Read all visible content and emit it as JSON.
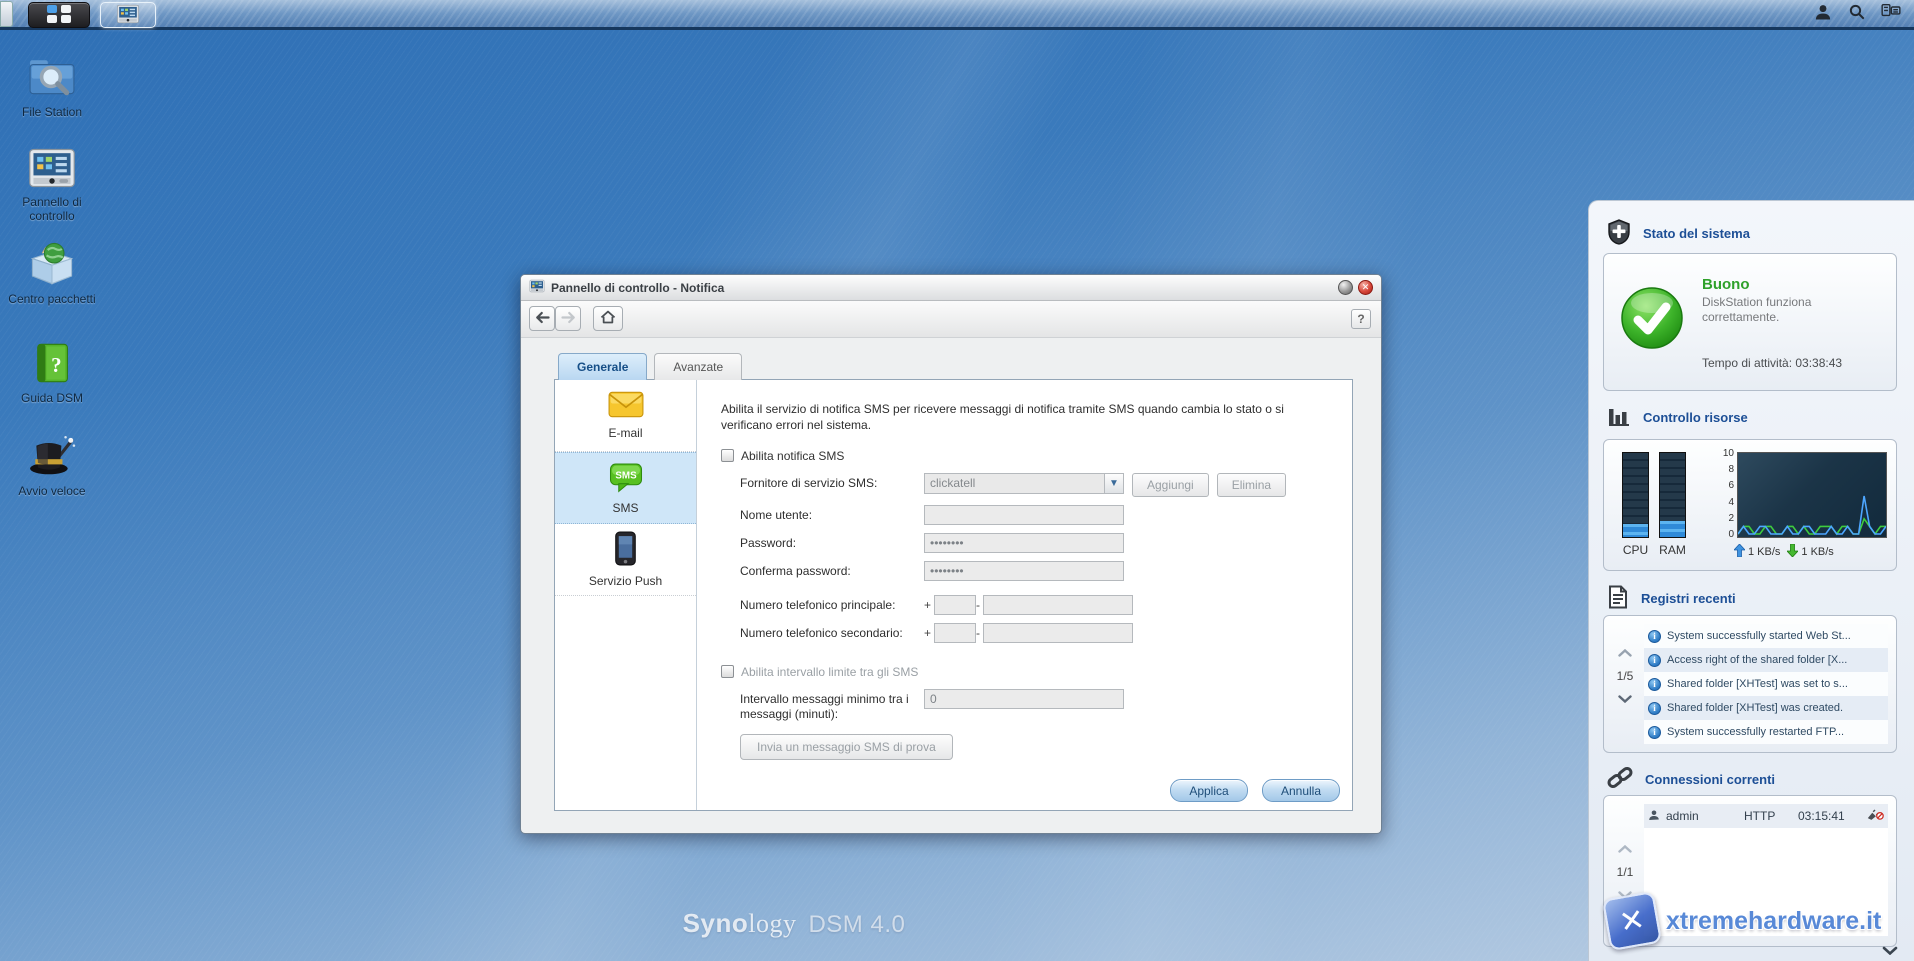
{
  "taskbar": {
    "main_menu_icon": "grid-menu-icon",
    "open_app_icon": "control-panel-icon",
    "user_icon": "user-icon",
    "search_icon": "search-icon",
    "pilot_icon": "pilot-view-icon"
  },
  "desktop": {
    "icons": [
      {
        "label": "File Station",
        "icon": "folder-search-icon"
      },
      {
        "label": "Pannello di controllo",
        "icon": "control-panel-icon"
      },
      {
        "label": "Centro pacchetti",
        "icon": "package-center-icon"
      },
      {
        "label": "Guida DSM",
        "icon": "help-book-icon"
      },
      {
        "label": "Avvio veloce",
        "icon": "quick-start-hat-icon"
      }
    ],
    "branding": {
      "brand_bold": "Syno",
      "brand_rest": "logy",
      "product": "DSM 4.0"
    },
    "watermark": "xtremehardware.it"
  },
  "dialog": {
    "title": "Pannello di controllo - Notifica",
    "help_label": "?",
    "tabs": [
      {
        "label": "Generale",
        "active": true
      },
      {
        "label": "Avanzate",
        "active": false
      }
    ],
    "sidebar": [
      {
        "label": "E-mail",
        "icon": "email-envelope-icon",
        "selected": false
      },
      {
        "label": "SMS",
        "icon": "sms-bubble-icon",
        "selected": true
      },
      {
        "label": "Servizio Push",
        "icon": "push-phone-icon",
        "selected": false
      }
    ],
    "form": {
      "description": "Abilita il servizio di notifica SMS per ricevere messaggi di notifica tramite SMS quando cambia lo stato o si verificano errori nel sistema.",
      "enable_checkbox_label": "Abilita notifica SMS",
      "provider_label": "Fornitore di servizio SMS:",
      "provider_value": "clickatell",
      "add_button": "Aggiungi",
      "delete_button": "Elimina",
      "username_label": "Nome utente:",
      "username_value": "",
      "password_label": "Password:",
      "password_value": "••••••••",
      "confirm_label": "Conferma password:",
      "confirm_value": "••••••••",
      "phone1_label": "Numero telefonico principale:",
      "phone2_label": "Numero telefonico secondario:",
      "phone_plus": "+",
      "phone_sep": "-",
      "interval_checkbox_label": "Abilita intervallo limite tra gli SMS",
      "interval_label": "Intervallo messaggi minimo tra i messaggi (minuti):",
      "interval_value": "0",
      "test_button": "Invia un messaggio SMS di prova",
      "apply_button": "Applica",
      "cancel_button": "Annulla"
    }
  },
  "widgets": {
    "system_health": {
      "title": "Stato del sistema",
      "status": "Buono",
      "message": "DiskStation funziona correttamente.",
      "uptime": "Tempo di attività: 03:38:43"
    },
    "resource_monitor": {
      "title": "Controllo risorse",
      "cpu_label": "CPU",
      "ram_label": "RAM",
      "cpu_percent": 16,
      "ram_percent": 19,
      "upload": "1 KB/s",
      "download": "1 KB/s",
      "chart_data": {
        "type": "line",
        "ylim": [
          0,
          10
        ],
        "yticks": [
          "10",
          "8",
          "6",
          "4",
          "2",
          "0"
        ],
        "series": [
          {
            "name": "download",
            "color": "#3ecc3e",
            "values": [
              0,
              1,
              1,
              0,
              0,
              1,
              1,
              0,
              0,
              1,
              1,
              0,
              1,
              0,
              0,
              1,
              1,
              1,
              0,
              1,
              1,
              0,
              0,
              2,
              1,
              0,
              1,
              1
            ]
          },
          {
            "name": "upload",
            "color": "#4da6ff",
            "values": [
              0,
              1,
              0,
              0,
              1,
              1,
              0,
              0,
              0,
              1,
              0,
              0,
              1,
              1,
              0,
              0,
              0,
              1,
              0,
              0,
              1,
              0,
              0,
              5,
              1,
              0,
              0,
              1
            ]
          }
        ]
      }
    },
    "recent_logs": {
      "title": "Registri recenti",
      "pager": "1/5",
      "entries": [
        {
          "text": "System successfully started Web St..."
        },
        {
          "text": "Access right of the shared folder [X..."
        },
        {
          "text": "Shared folder [XHTest] was set to s..."
        },
        {
          "text": "Shared folder [XHTest] was created."
        },
        {
          "text": "System successfully restarted FTP..."
        }
      ]
    },
    "connections": {
      "title": "Connessioni correnti",
      "pager": "1/1",
      "rows": [
        {
          "user": "admin",
          "protocol": "HTTP",
          "time": "03:15:41"
        }
      ]
    }
  }
}
